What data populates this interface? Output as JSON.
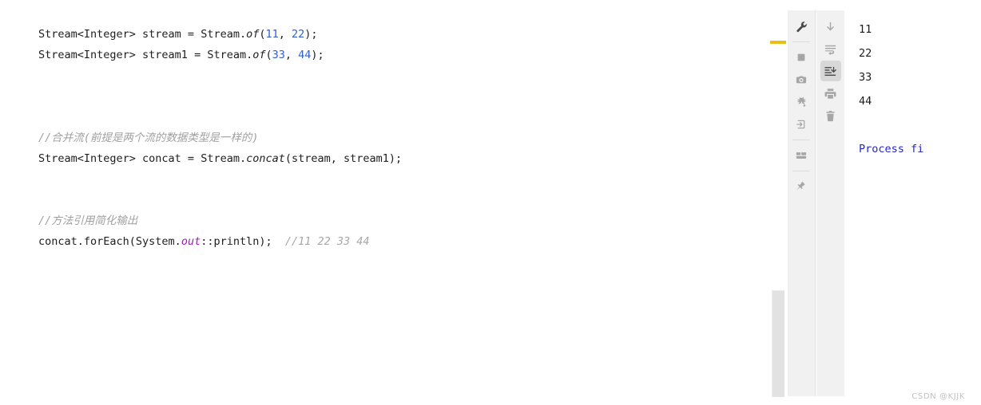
{
  "editor": {
    "lines": [
      {
        "id": "line-1",
        "segments": [
          {
            "text": "Stream<Integer> stream = Stream.",
            "cls": "tok-plain"
          },
          {
            "text": "of",
            "cls": "tok-method"
          },
          {
            "text": "(",
            "cls": "tok-plain"
          },
          {
            "text": "11",
            "cls": "tok-num"
          },
          {
            "text": ", ",
            "cls": "tok-plain"
          },
          {
            "text": "22",
            "cls": "tok-num"
          },
          {
            "text": ");",
            "cls": "tok-plain"
          }
        ]
      },
      {
        "id": "line-2",
        "segments": [
          {
            "text": "Stream<Integer> stream1 = Stream.",
            "cls": "tok-plain"
          },
          {
            "text": "of",
            "cls": "tok-method"
          },
          {
            "text": "(",
            "cls": "tok-plain"
          },
          {
            "text": "33",
            "cls": "tok-num"
          },
          {
            "text": ", ",
            "cls": "tok-plain"
          },
          {
            "text": "44",
            "cls": "tok-num"
          },
          {
            "text": ");",
            "cls": "tok-plain"
          }
        ]
      },
      {
        "id": "line-3",
        "segments": [
          {
            "text": " ",
            "cls": "tok-plain"
          }
        ]
      },
      {
        "id": "line-4",
        "segments": [
          {
            "text": " ",
            "cls": "tok-plain"
          }
        ]
      },
      {
        "id": "line-5",
        "segments": [
          {
            "text": " ",
            "cls": "tok-plain"
          }
        ]
      },
      {
        "id": "line-6",
        "segments": [
          {
            "text": "//合并流(前提是两个流的数据类型是一样的)",
            "cls": "tok-comment"
          }
        ]
      },
      {
        "id": "line-7",
        "segments": [
          {
            "text": "Stream<Integer> concat = Stream.",
            "cls": "tok-plain"
          },
          {
            "text": "concat",
            "cls": "tok-method"
          },
          {
            "text": "(stream, stream1);",
            "cls": "tok-plain"
          }
        ]
      },
      {
        "id": "line-8",
        "segments": [
          {
            "text": " ",
            "cls": "tok-plain"
          }
        ]
      },
      {
        "id": "line-9",
        "segments": [
          {
            "text": " ",
            "cls": "tok-plain"
          }
        ]
      },
      {
        "id": "line-10",
        "segments": [
          {
            "text": "//方法引用简化输出",
            "cls": "tok-comment"
          }
        ]
      },
      {
        "id": "line-11",
        "segments": [
          {
            "text": "concat.forEach(System.",
            "cls": "tok-plain"
          },
          {
            "text": "out",
            "cls": "tok-field"
          },
          {
            "text": "::println);  ",
            "cls": "tok-plain"
          },
          {
            "text": "//11 22 33 44",
            "cls": "tok-comment-tail"
          }
        ]
      }
    ]
  },
  "toolbar_left": {
    "items": [
      {
        "name": "settings-wrench-icon",
        "label": "Settings",
        "icon": "wrench",
        "active": false,
        "separator_after": true
      },
      {
        "name": "stop-icon",
        "label": "Stop",
        "icon": "stop",
        "active": false,
        "separator_after": false
      },
      {
        "name": "camera-icon",
        "label": "Capture Memory Snapshot",
        "icon": "camera",
        "active": false,
        "separator_after": false
      },
      {
        "name": "thread-dump-icon",
        "label": "Thread Dump",
        "icon": "thread-dump",
        "active": false,
        "separator_after": false
      },
      {
        "name": "attach-process-icon",
        "label": "Attach Debugger to Process",
        "icon": "attach",
        "active": false,
        "separator_after": true
      },
      {
        "name": "layout-icon",
        "label": "Layout Settings",
        "icon": "layout",
        "active": false,
        "separator_after": true
      },
      {
        "name": "pin-icon",
        "label": "Pin Tab",
        "icon": "pin",
        "active": false,
        "separator_after": false
      }
    ]
  },
  "toolbar_right": {
    "items": [
      {
        "name": "scroll-down-icon",
        "label": "Scroll to End",
        "icon": "arrow-down",
        "active": false
      },
      {
        "name": "soft-wrap-icon",
        "label": "Use Soft Wraps",
        "icon": "soft-wrap",
        "active": false
      },
      {
        "name": "scroll-to-end-icon",
        "label": "Scroll to the end",
        "icon": "scroll-end",
        "active": true
      },
      {
        "name": "print-icon",
        "label": "Print",
        "icon": "printer",
        "active": false
      },
      {
        "name": "clear-all-icon",
        "label": "Clear All",
        "icon": "trash",
        "active": false
      }
    ]
  },
  "console": {
    "lines": [
      {
        "id": "console-line-1",
        "text": "11",
        "cls": "out-normal"
      },
      {
        "id": "console-line-2",
        "text": "22",
        "cls": "out-normal"
      },
      {
        "id": "console-line-3",
        "text": "33",
        "cls": "out-normal"
      },
      {
        "id": "console-line-4",
        "text": "44",
        "cls": "out-normal"
      },
      {
        "id": "console-line-5",
        "text": " ",
        "cls": "out-normal"
      },
      {
        "id": "console-line-6",
        "text": "Process fi",
        "cls": "out-info"
      }
    ]
  },
  "colors": {
    "number_literal": "#2f5fd0",
    "comment": "#a0a0a0",
    "static_field": "#9b20b0",
    "console_info": "#2424d4",
    "warning_marker": "#e8bf14",
    "toolbar_bg": "#f1f1f1",
    "toolbar_active": "#d8d8d8"
  },
  "watermark": {
    "text": "CSDN @KJJK"
  }
}
